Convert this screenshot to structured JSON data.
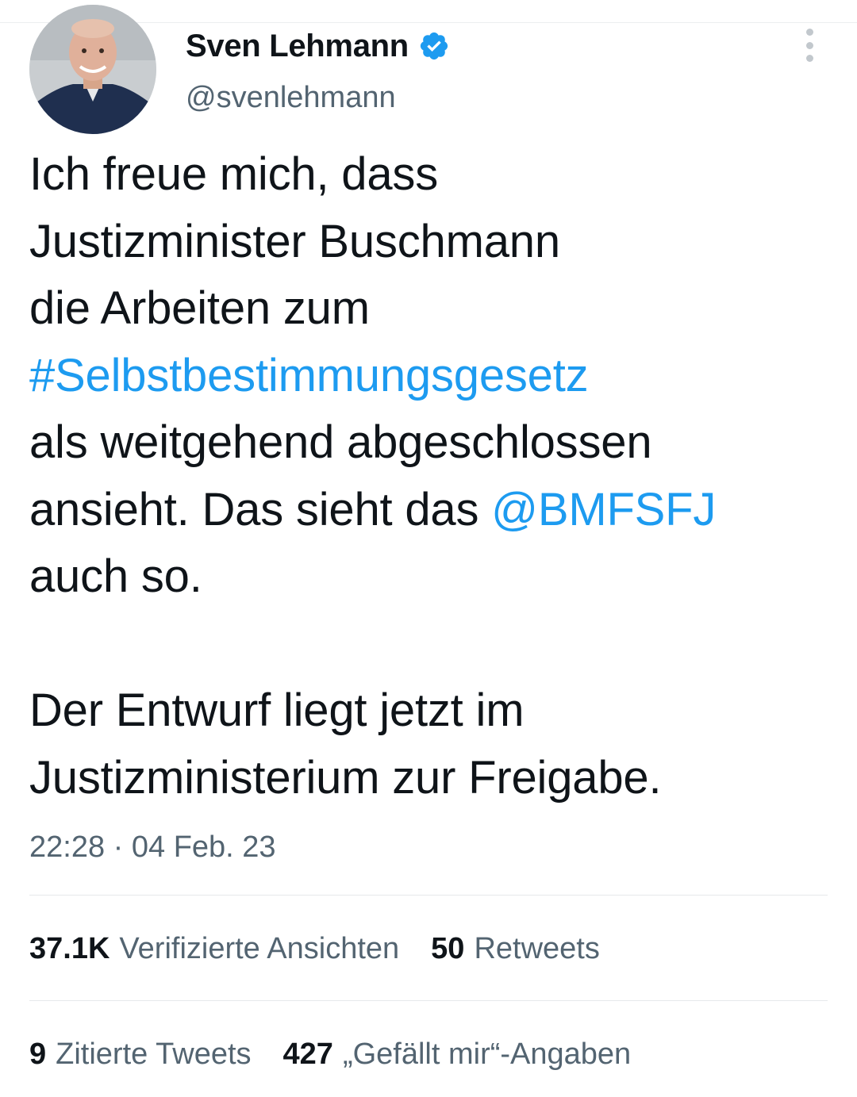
{
  "author": {
    "display_name": "Sven Lehmann",
    "handle": "@svenlehmann"
  },
  "tweet": {
    "lines": [
      "Ich freue mich, dass",
      "Justizminister Buschmann",
      "die Arbeiten zum"
    ],
    "hashtag": "#Selbstbestimmungsgesetz",
    "line5": "als weitgehend abgeschlossen",
    "line6_prefix": "ansieht. Das sieht das ",
    "mention": "@BMFSFJ",
    "line7": "auch so.",
    "line8": "Der Entwurf liegt jetzt im",
    "line9": "Justizministerium zur Freigabe."
  },
  "meta": {
    "time": "22:28",
    "separator": "·",
    "date": "04 Feb. 23"
  },
  "stats": {
    "views_count": "37.1K",
    "views_label": "Verifizierte Ansichten",
    "retweets_count": "50",
    "retweets_label": "Retweets",
    "quotes_count": "9",
    "quotes_label": "Zitierte Tweets",
    "likes_count": "427",
    "likes_label": "„Gefällt mir“-Angaben"
  },
  "colors": {
    "link": "#1d9bf0",
    "secondary_text": "#536471",
    "primary_text": "#0f1419",
    "verified_badge": "#1d9bf0"
  },
  "icons": {
    "verified": "verified-badge-icon",
    "more": "more-options-icon"
  }
}
